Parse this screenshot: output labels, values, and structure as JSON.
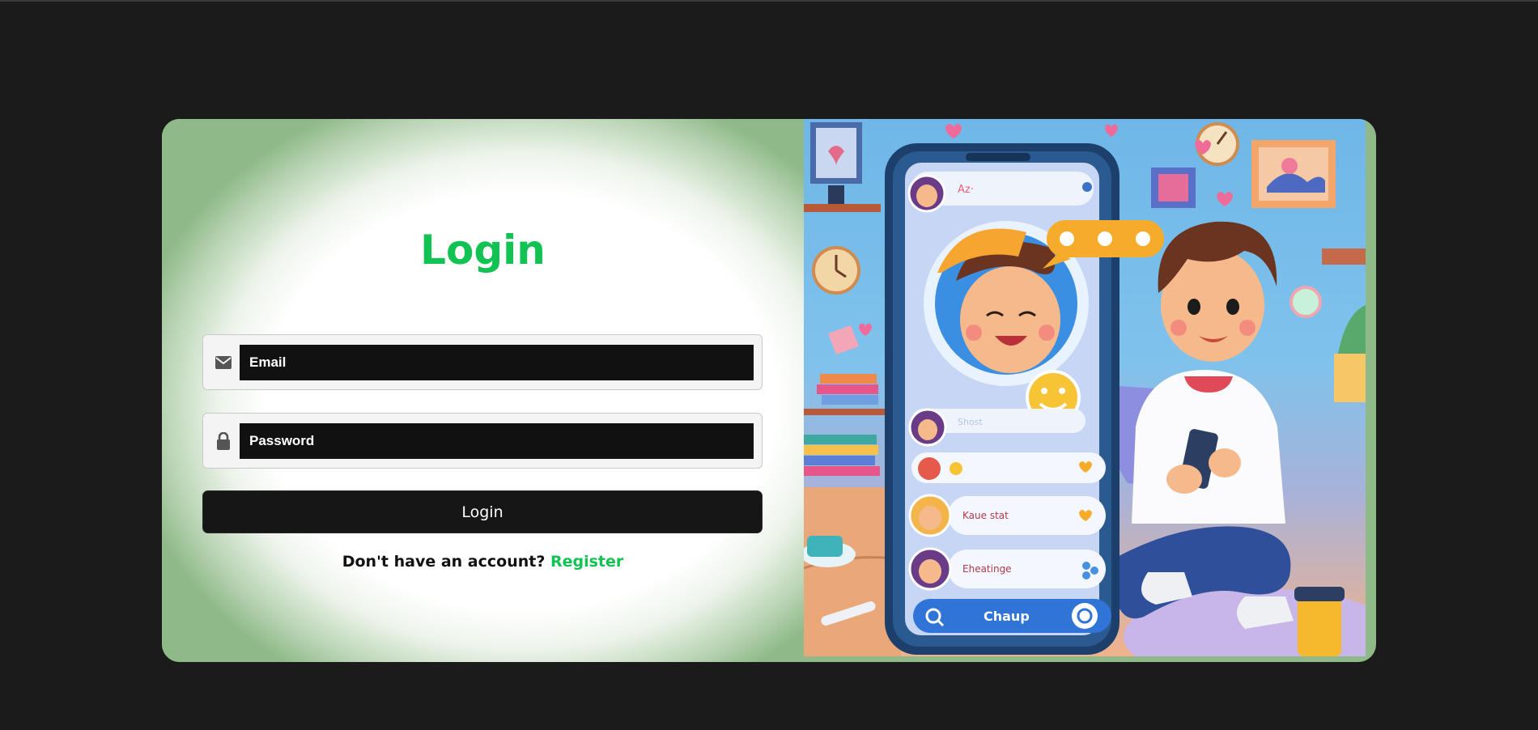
{
  "login": {
    "title": "Login",
    "email_placeholder": "Email",
    "password_placeholder": "Password",
    "submit_label": "Login",
    "register_prompt": "Don't have an account?",
    "register_link": "Register"
  },
  "illustration": {
    "header_name": "Az·",
    "chat_rows": [
      {
        "name": "Shost"
      },
      {
        "name": ""
      },
      {
        "name": "Kaue stat"
      },
      {
        "name": "Eheatinge"
      }
    ],
    "bottom_bar_label": "Chaup"
  },
  "colors": {
    "accent_green": "#12c253",
    "button_dark": "#161616",
    "page_background": "#1b1b1b"
  },
  "icons": {
    "email": "envelope-icon",
    "password": "lock-icon"
  }
}
